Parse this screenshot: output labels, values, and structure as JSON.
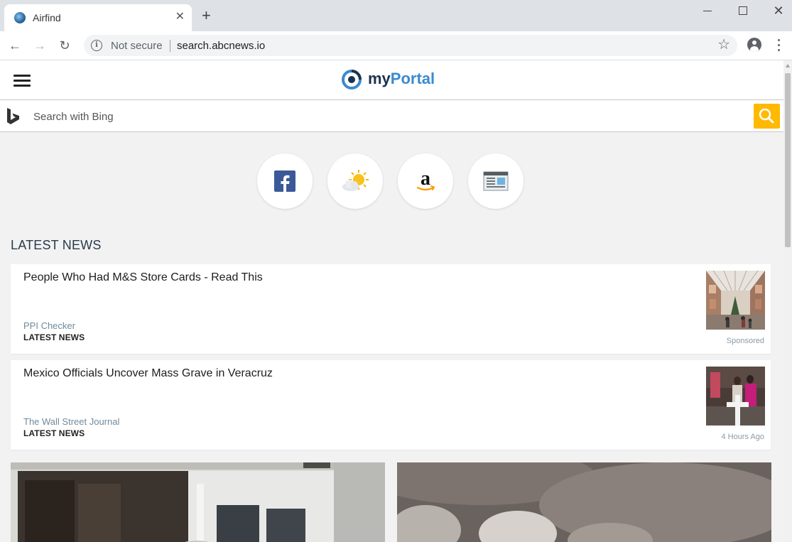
{
  "browser": {
    "tab_title": "Airfind",
    "tab_close": "✕",
    "new_tab": "+",
    "close_window": "✕",
    "security_label": "Not secure",
    "url": "search.abcnews.io",
    "back": "←",
    "forward": "→",
    "reload": "↻",
    "bookmark": "☆"
  },
  "site": {
    "logo_my": "my",
    "logo_portal": "Portal",
    "search_placeholder": "Search with Bing",
    "quick_links": [
      {
        "icon": "facebook-icon"
      },
      {
        "icon": "weather-icon"
      },
      {
        "icon": "amazon-icon"
      },
      {
        "icon": "news-icon"
      }
    ]
  },
  "news": {
    "section_title": "LATEST NEWS",
    "items": [
      {
        "headline": "People Who Had M&S Store Cards - Read This",
        "source": "PPI Checker",
        "category": "LATEST NEWS",
        "meta": "Sponsored"
      },
      {
        "headline": "Mexico Officials Uncover Mass Grave in Veracruz",
        "source": "The Wall Street Journal",
        "category": "LATEST NEWS",
        "meta": "4 Hours Ago"
      }
    ]
  },
  "colors": {
    "accent": "#3a8ad0",
    "search_button": "#ffb900",
    "page_background": "#f2f2f2"
  }
}
